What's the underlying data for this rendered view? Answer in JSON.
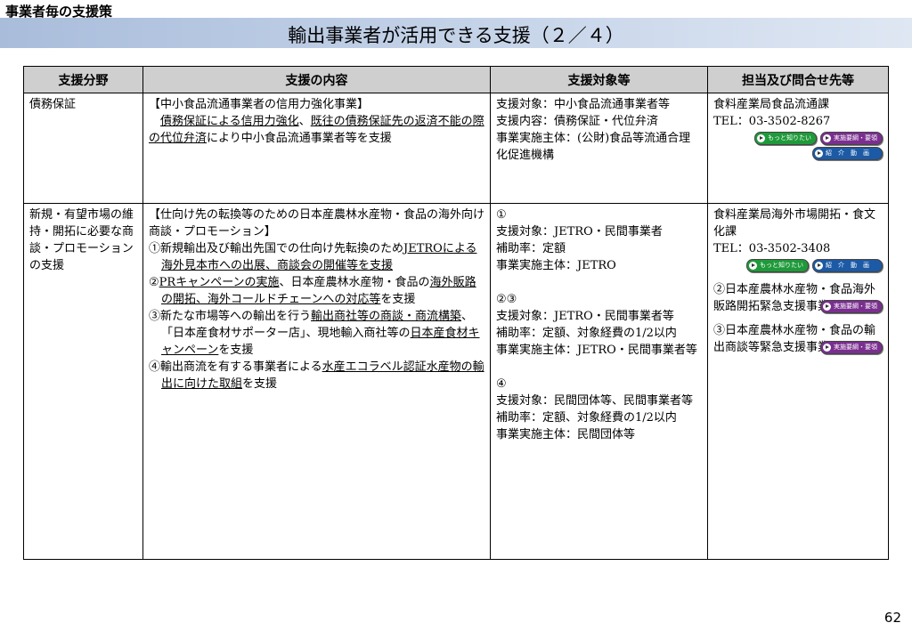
{
  "header": {
    "section_label": "事業者毎の支援策",
    "title": "輸出事業者が活用できる支援（２／４）"
  },
  "table": {
    "headers": [
      "支援分野",
      "支援の内容",
      "支援対象等",
      "担当及び問合せ先等"
    ],
    "row1": {
      "field": "債務保証",
      "content": {
        "heading": "【中小食品流通事業者の信用力強化事業】",
        "u1": "債務保証による信用力強化",
        "sep": "、",
        "u2": "既往の債務保証先の返済不能の際の代位弁済",
        "rest": "により中小食品流通事業者等を支援"
      },
      "target": {
        "l1": "支援対象：中小食品流通事業者等",
        "l2": "支援内容：債務保証・代位弁済",
        "l3": "事業実施主体：(公財)食品等流通合理化促進機構"
      },
      "contact": {
        "dept": "食料産業局食品流通課",
        "tel": "TEL：03-3502-8267",
        "btn_more": "もっと知りたい",
        "btn_guide": "実施要綱・要領",
        "btn_video": "紹　介　動　画"
      }
    },
    "row2": {
      "field": "新規・有望市場の維持・開拓に必要な商談・プロモーションの支援",
      "content": {
        "heading": "【仕向け先の転換等のための日本産農林水産物・食品の海外向け商談・プロモーション】",
        "i1_pre": "①新規輸出及び輸出先国での仕向け先転換のため",
        "i1_u": "JETROによる海外見本市への出展、商談会の開催等を支援",
        "i2_pre": "②",
        "i2_u1": "PRキャンペーンの実施",
        "i2_mid": "、日本産農林水産物・食品の",
        "i2_u2": "海外販路の開拓、海外コールドチェーンへの対応等",
        "i2_post": "を支援",
        "i3_pre": "③新たな市場等への輸出を行う",
        "i3_u1": "輸出商社等の商談・商流構築",
        "i3_mid": "、「日本産食材サポーター店」、現地輸入商社等の",
        "i3_u2": "日本産食材キャンペーン",
        "i3_post": "を支援",
        "i4_pre": "④輸出商流を有する事業者による",
        "i4_u": "水産エコラベル認証水産物の輸出に向けた取組",
        "i4_post": "を支援"
      },
      "target": {
        "g1_num": "①",
        "g1_l1": "支援対象：JETRO・民間事業者",
        "g1_l2": "補助率：定額",
        "g1_l3": "事業実施主体：JETRO",
        "g2_num": "②③",
        "g2_l1": "支援対象：JETRO・民間事業者等",
        "g2_l2": "補助率：定額、対象経費の1/2以内",
        "g2_l3": "事業実施主体：JETRO・民間事業者等",
        "g3_num": "④",
        "g3_l1": "支援対象：民間団体等、民間事業者等",
        "g3_l2": "補助率：定額、対象経費の1/2以内",
        "g3_l3": "事業実施主体：民間団体等"
      },
      "contact": {
        "dept": "食料産業局海外市場開拓・食文化課",
        "tel": "TEL：03-3502-3408",
        "btn_more": "もっと知りたい",
        "btn_video": "紹　介　動　画",
        "c2": "②日本産農林水産物・食品海外販路開拓緊急支援事業",
        "btn_guide2": "実施要綱・要領",
        "c3": "③日本産農林水産物・食品の輸出商談等緊急支援事業",
        "btn_guide3": "実施要綱・要領"
      }
    }
  },
  "colors": {
    "title_bar": "#b8c9e3",
    "header_bg": "#cfcfcf",
    "btn_green": "#1f9a3a",
    "btn_purple": "#7a2f8f",
    "btn_blue": "#1c5aa6"
  },
  "icons": {
    "button_icon": "play-circle-icon"
  },
  "footer": {
    "page_number": "62"
  }
}
